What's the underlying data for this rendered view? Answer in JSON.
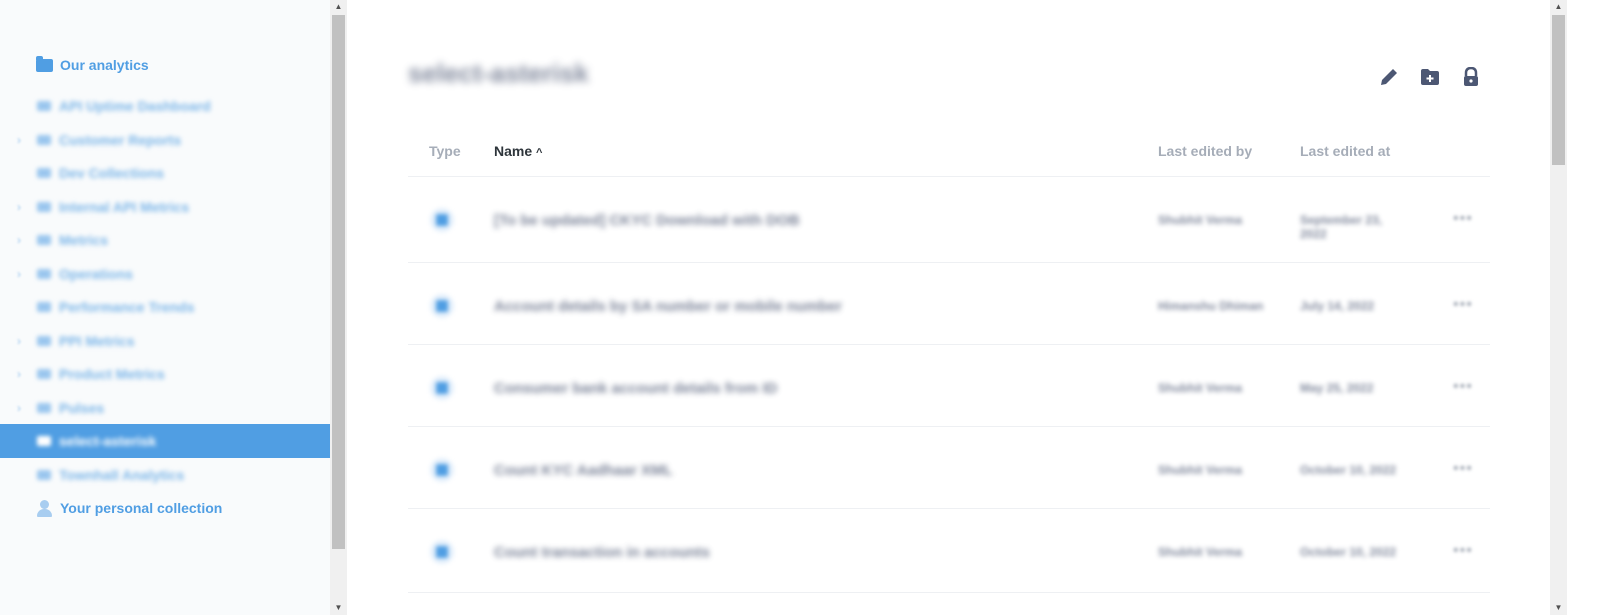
{
  "sidebar": {
    "root_label": "Our analytics",
    "items": [
      {
        "label": "API Uptime Dashboard",
        "expandable": false,
        "selected": false
      },
      {
        "label": "Customer Reports",
        "expandable": true,
        "selected": false
      },
      {
        "label": "Dev Collections",
        "expandable": false,
        "selected": false
      },
      {
        "label": "Internal API Metrics",
        "expandable": true,
        "selected": false
      },
      {
        "label": "Metrics",
        "expandable": true,
        "selected": false
      },
      {
        "label": "Operations",
        "expandable": true,
        "selected": false
      },
      {
        "label": "Performance Trends",
        "expandable": false,
        "selected": false
      },
      {
        "label": "PPI Metrics",
        "expandable": true,
        "selected": false
      },
      {
        "label": "Product Metrics",
        "expandable": true,
        "selected": false
      },
      {
        "label": "Pulses",
        "expandable": true,
        "selected": false
      },
      {
        "label": "select-asterisk",
        "expandable": false,
        "selected": true
      },
      {
        "label": "Townhall Analytics",
        "expandable": false,
        "selected": false
      }
    ],
    "personal_label": "Your personal collection"
  },
  "main": {
    "title": "select-asterisk",
    "actions": [
      {
        "name": "edit-button",
        "icon": "pencil-icon"
      },
      {
        "name": "new-collection-button",
        "icon": "folder-plus-icon"
      },
      {
        "name": "permissions-button",
        "icon": "lock-icon"
      }
    ],
    "columns": {
      "type": "Type",
      "name": "Name",
      "sort_indicator": "^",
      "last_edited_by": "Last edited by",
      "last_edited_at": "Last edited at"
    },
    "rows": [
      {
        "name": "[To be updated] CKYC Download with DOB",
        "by": "Shubhit Verma",
        "at": "September 23, 2022"
      },
      {
        "name": "Account details by SA number or mobile number",
        "by": "Himanshu Dhiman",
        "at": "July 14, 2022"
      },
      {
        "name": "Consumer bank account details from ID",
        "by": "Shubhit Verma",
        "at": "May 25, 2022"
      },
      {
        "name": "Count KYC Aadhaar XML",
        "by": "Shubhit Verma",
        "at": "October 10, 2022"
      },
      {
        "name": "Count transaction in accounts",
        "by": "Shubhit Verma",
        "at": "October 10, 2022"
      }
    ],
    "more_label": "•••"
  },
  "colors": {
    "brand": "#509ee3",
    "text_dark": "#4c5773",
    "text_muted": "#a6adb8"
  }
}
